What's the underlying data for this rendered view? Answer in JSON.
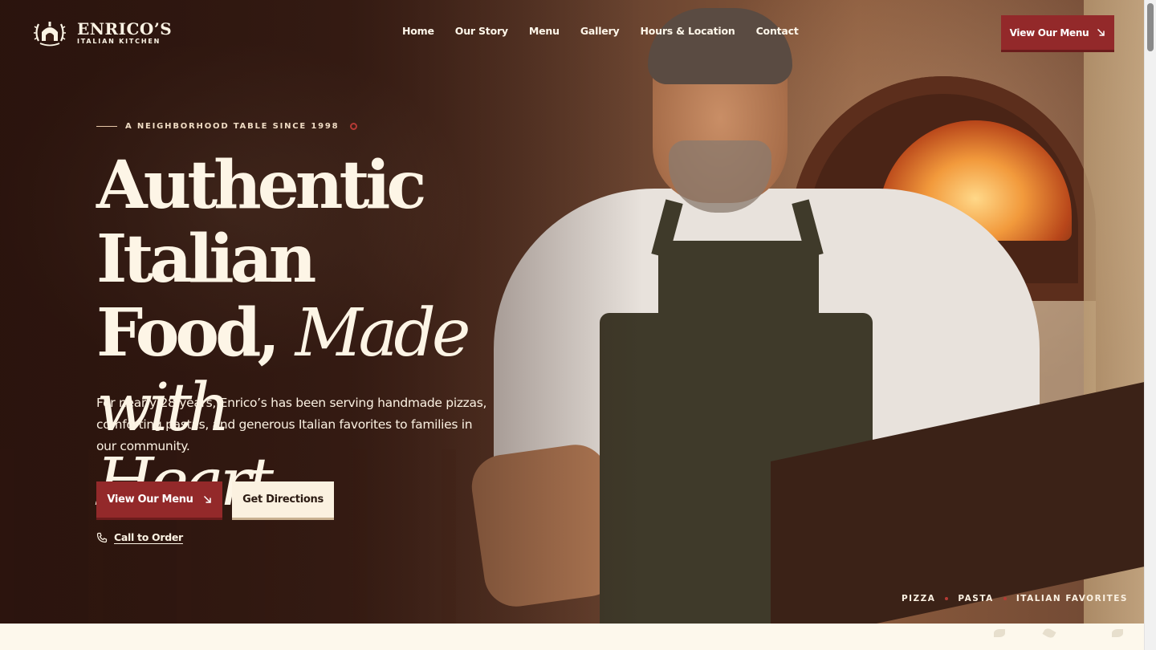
{
  "header": {
    "logo_name": "ENRICO’S",
    "logo_sub": "ITALIAN KITCHEN",
    "nav": [
      "Home",
      "Our Story",
      "Menu",
      "Gallery",
      "Hours & Location",
      "Contact"
    ],
    "cta_label": "View Our Menu"
  },
  "hero": {
    "eyebrow": "A NEIGHBORHOOD TABLE SINCE 1998",
    "headline_1": "Authentic Italian",
    "headline_2a": "Food, ",
    "headline_2b": "Made with",
    "headline_3": "Heart.",
    "lead": "For nearly 28 years, Enrico’s has been serving handmade pizzas, comforting pastas, and generous Italian favorites to families in our community.",
    "primary_button": "View Our Menu",
    "secondary_button": "Get Directions",
    "call_label": "Call to Order",
    "tags": [
      "PIZZA",
      "PASTA",
      "ITALIAN FAVORITES"
    ]
  },
  "colors": {
    "accent": "#93292a",
    "cream": "#fbf1e0",
    "dark": "#3a1e15"
  },
  "icons": {
    "logo": "oven-wreath-icon",
    "arrow": "arrow-down-right-icon",
    "phone": "phone-icon"
  }
}
